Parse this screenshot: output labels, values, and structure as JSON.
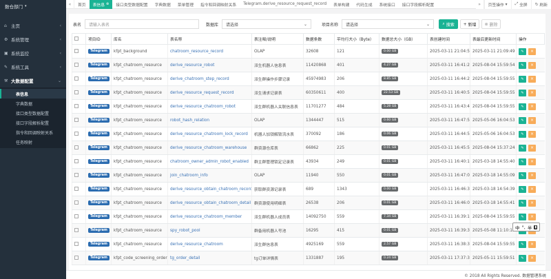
{
  "sidebar": {
    "header": "数仓部门",
    "menu": [
      {
        "icon": "home-icon",
        "glyph": "⌂",
        "label": "主页",
        "arrow": "‹"
      },
      {
        "icon": "settings-icon",
        "glyph": "⚙",
        "label": "系统管理",
        "arrow": "‹"
      },
      {
        "icon": "monitor-icon",
        "glyph": "▣",
        "label": "系统监控",
        "arrow": "‹"
      },
      {
        "icon": "tools-icon",
        "glyph": "✎",
        "label": "系统工具",
        "arrow": "‹"
      },
      {
        "icon": "config-icon",
        "glyph": "⚒",
        "label": "大数据配置",
        "arrow": "⌄",
        "active": true
      }
    ],
    "submenu": [
      {
        "label": "表信息",
        "active": true
      },
      {
        "label": "字典数据"
      },
      {
        "label": "接口类型数据配置"
      },
      {
        "label": "接口字段解析配置"
      },
      {
        "label": "指令和回调映射关系"
      },
      {
        "label": "任务映射"
      }
    ]
  },
  "tabs": [
    {
      "label": "首页"
    },
    {
      "label": "表信息",
      "active": true
    },
    {
      "label": "接口类型数据配置"
    },
    {
      "label": "字典数据"
    },
    {
      "label": "菜单管理"
    },
    {
      "label": "指令和回调映射关系"
    },
    {
      "label": "Telegram.derive_resource_request_record"
    },
    {
      "label": "表单构建"
    },
    {
      "label": "代码生成"
    },
    {
      "label": "系统接口"
    },
    {
      "label": "接口字段解析配置"
    }
  ],
  "tab_right": {
    "ops": "页签操作",
    "fullscreen": "全屏",
    "refresh": "刷新"
  },
  "search": {
    "table_name_label": "表名",
    "table_name_placeholder": "请输入表名",
    "db_label": "数据库",
    "db_value": "请选择",
    "project_label": "项目名称",
    "project_value": "请选择",
    "search_btn": "搜索",
    "add_btn": "新增",
    "delete_btn": "删除"
  },
  "table": {
    "headers": [
      "",
      "项目ID",
      "库名",
      "表名称",
      "表注释/说明",
      "数据条数",
      "平均行大小（Byte）",
      "数据总大小（GB）",
      "表创建时间",
      "表最后更新时间",
      "操作"
    ],
    "rows": [
      {
        "project": "Telegram",
        "db": "kfpt_background",
        "name": "chatroom_resource_record",
        "comment": "OLAP",
        "count": "32608",
        "avg": "121",
        "size": "0.00 GB",
        "created": "2025-03-11 21:04:59",
        "updated": "2025-03-11 21:09:49"
      },
      {
        "project": "Telegram",
        "db": "kfpt_chatroom_resource",
        "name": "derive_resource_robot",
        "comment": "派生机器人信息表",
        "count": "11420868",
        "avg": "401",
        "size": "4.27 GB",
        "created": "2025-03-11 16:41:26",
        "updated": "2025-08-04 15:59:54"
      },
      {
        "project": "Telegram",
        "db": "kfpt_chatroom_resource",
        "name": "derive_chatroom_step_record",
        "comment": "派生群操作步骤记录",
        "count": "45974983",
        "avg": "206",
        "size": "8.85 GB",
        "created": "2025-03-11 16:44:29",
        "updated": "2025-08-04 15:59:55"
      },
      {
        "project": "Telegram",
        "db": "kfpt_chatroom_resource",
        "name": "derive_resource_request_record",
        "comment": "派生请求记录表",
        "count": "60350611",
        "avg": "400",
        "size": "22.53 GB",
        "created": "2025-03-11 16:40:52",
        "updated": "2025-08-04 15:59:55"
      },
      {
        "project": "Telegram",
        "db": "kfpt_chatroom_resource",
        "name": "derive_resource_chatroom_robot",
        "comment": "派生群机器人关联信息表",
        "count": "11701277",
        "avg": "484",
        "size": "5.28 GB",
        "created": "2025-03-11 16:43:49",
        "updated": "2025-08-04 15:59:55"
      },
      {
        "project": "Telegram",
        "db": "kfpt_chatroom_resource",
        "name": "robot_hash_relation",
        "comment": "OLAP",
        "count": "1344447",
        "avg": "515",
        "size": "0.60 GB",
        "created": "2025-03-11 16:47:50",
        "updated": "2025-05-06 16:04:53"
      },
      {
        "project": "Telegram",
        "db": "kfpt_chatroom_resource",
        "name": "derive_resource_chatroom_lock_record",
        "comment": "机器人加锁解锁流水表",
        "count": "370092",
        "avg": "186",
        "size": "0.06 GB",
        "created": "2025-03-11 16:44:59",
        "updated": "2025-05-06 16:04:53"
      },
      {
        "project": "Telegram",
        "db": "kfpt_chatroom_resource",
        "name": "derive_resource_chatroom_warehouse",
        "comment": "群资源仓库表",
        "count": "66862",
        "avg": "225",
        "size": "0.01 GB",
        "created": "2025-03-11 16:45:52",
        "updated": "2025-08-04 15:37:24"
      },
      {
        "project": "Telegram",
        "db": "kfpt_chatroom_resource",
        "name": "chatroom_owner_admin_robot_enabled",
        "comment": "群主群管理锁定记录表",
        "count": "43934",
        "avg": "249",
        "size": "0.01 GB",
        "created": "2025-03-11 16:40:11",
        "updated": "2025-03-18 14:55:40"
      },
      {
        "project": "Telegram",
        "db": "kfpt_chatroom_resource",
        "name": "join_chatroom_info",
        "comment": "OLAP",
        "count": "11940",
        "avg": "550",
        "size": "0.01 GB",
        "created": "2025-03-11 16:47:02",
        "updated": "2025-03-18 14:55:09"
      },
      {
        "project": "Telegram",
        "db": "kfpt_chatroom_resource",
        "name": "derive_resource_obtain_chatroom_record",
        "comment": "获取群资源记录表",
        "count": "689",
        "avg": "1343",
        "size": "0.00 GB",
        "created": "2025-03-11 16:46:36",
        "updated": "2025-03-18 14:54:39"
      },
      {
        "project": "Telegram",
        "db": "kfpt_chatroom_resource",
        "name": "derive_resource_obtain_chatroom_detail",
        "comment": "群资源使用明细表",
        "count": "26538",
        "avg": "206",
        "size": "0.01 GB",
        "created": "2025-03-11 16:46:05",
        "updated": "2025-03-18 14:55:41"
      },
      {
        "project": "Telegram",
        "db": "kfpt_chatroom_resource",
        "name": "derive_resource_chatroom_member",
        "comment": "派生群机器人成员表",
        "count": "14092750",
        "avg": "559",
        "size": "7.34 GB",
        "created": "2025-03-11 16:39:12",
        "updated": "2025-08-04 15:59:55"
      },
      {
        "project": "Telegram",
        "db": "kfpt_chatroom_resource",
        "name": "spy_robot_pool",
        "comment": "群备用机器人号池",
        "count": "16295",
        "avg": "415",
        "size": "0.01 GB",
        "created": "2025-03-11 16:39:37",
        "updated": "2025-05-08 11:10:19"
      },
      {
        "project": "Telegram",
        "db": "kfpt_chatroom_resource",
        "name": "derive_resource_chatroom",
        "comment": "派生群信息表",
        "count": "4925169",
        "avg": "559",
        "size": "2.57 GB",
        "created": "2025-03-11 16:38:36",
        "updated": "2025-08-04 15:59:55"
      },
      {
        "project": "Telegram",
        "db": "kfpt_code_screening_order",
        "name": "tg_order_detail",
        "comment": "tg订单详情表",
        "count": "1331887",
        "avg": "195",
        "size": "0.24 GB",
        "created": "2025-03-11 17:37:38",
        "updated": "2025-05-11 15:59:51"
      }
    ]
  },
  "footer": "© 2018 All Rights Reserved. 数据管理系统",
  "ime": {
    "text": "中",
    "dot": "°,",
    "half": "半",
    "shirt": "👕"
  }
}
